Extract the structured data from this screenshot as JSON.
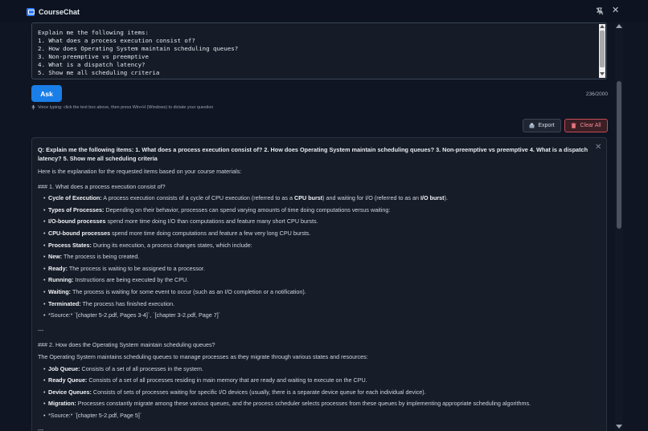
{
  "app": {
    "title": "CourseChat"
  },
  "question_input": {
    "value": "Explain me the following items:\n1. What does a process execution consist of?\n2. How does Operating System maintain scheduling queues?\n3. Non-preemptive vs preemptive\n4. What is a dispatch latency?\n5. Show me all scheduling criteria"
  },
  "ask_button": {
    "label": "Ask"
  },
  "char_count": "236/2000",
  "voice_hint": "Voice typing: click the text box above, then press Win+H (Windows) to dictate your question",
  "toolbar": {
    "export_label": "Export",
    "clear_label": "Clear All"
  },
  "answer": {
    "question": "Q: Explain me the following items: 1. What does a process execution consist of? 2. How does Operating System maintain scheduling queues? 3. Non-preemptive vs preemptive 4. What is a dispatch latency? 5. Show me all scheduling criteria",
    "intro": "Here is the explanation for the requested items based on your course materials:",
    "s1_heading": "### 1. What does a process execution consist of?",
    "s1_b1_label": "Cycle of Execution:",
    "s1_b1_pre": " A process execution consists of a cycle of CPU execution (referred to as a ",
    "s1_b1_bold1": "CPU burst",
    "s1_b1_mid": ") and waiting for I/O (referred to as an ",
    "s1_b1_bold2": "I/O burst",
    "s1_b1_end": ").",
    "s1_b2_label": "Types of Processes:",
    "s1_b2_text": " Depending on their behavior, processes can spend varying amounts of time doing computations versus waiting:",
    "s1_b3_label": "I/O-bound processes",
    "s1_b3_text": " spend more time doing I/O than computations and feature many short CPU bursts.",
    "s1_b4_label": "CPU-bound processes",
    "s1_b4_text": " spend more time doing computations and feature a few very long CPU bursts.",
    "s1_b5_label": "Process States:",
    "s1_b5_text": " During its execution, a process changes states, which include:",
    "s1_b6_label": "New:",
    "s1_b6_text": " The process is being created.",
    "s1_b7_label": "Ready:",
    "s1_b7_text": " The process is waiting to be assigned to a processor.",
    "s1_b8_label": "Running:",
    "s1_b8_text": " Instructions are being executed by the CPU.",
    "s1_b9_label": "Waiting:",
    "s1_b9_text": " The process is waiting for some event to occur (such as an I/O completion or a notification).",
    "s1_b10_label": "Terminated:",
    "s1_b10_text": " The process has finished execution.",
    "s1_source": "*Source:* `[chapter 5-2.pdf, Pages 3-4]`, `[chapter 3-2.pdf, Page 7]`",
    "separator": "---",
    "s2_heading": "### 2. How does the Operating System maintain scheduling queues?",
    "s2_intro": "The Operating System maintains scheduling queues to manage processes as they migrate through various states and resources:",
    "s2_b1_label": "Job Queue:",
    "s2_b1_text": " Consists of a set of all processes in the system.",
    "s2_b2_label": "Ready Queue:",
    "s2_b2_text": " Consists of a set of all processes residing in main memory that are ready and waiting to execute on the CPU.",
    "s2_b3_label": "Device Queues:",
    "s2_b3_text": " Consists of sets of processes waiting for specific I/O devices (usually, there is a separate device queue for each individual device).",
    "s2_b4_label": "Migration:",
    "s2_b4_text": " Processes constantly migrate among these various queues, and the process scheduler selects processes from these queues by implementing appropriate scheduling algorithms.",
    "s2_source": "*Source:* `[chapter 5-2.pdf, Page 5]`",
    "separator2": "---"
  },
  "colors": {
    "accent": "#1a7ee8",
    "danger": "#c44a55",
    "background": "#0f1522"
  }
}
